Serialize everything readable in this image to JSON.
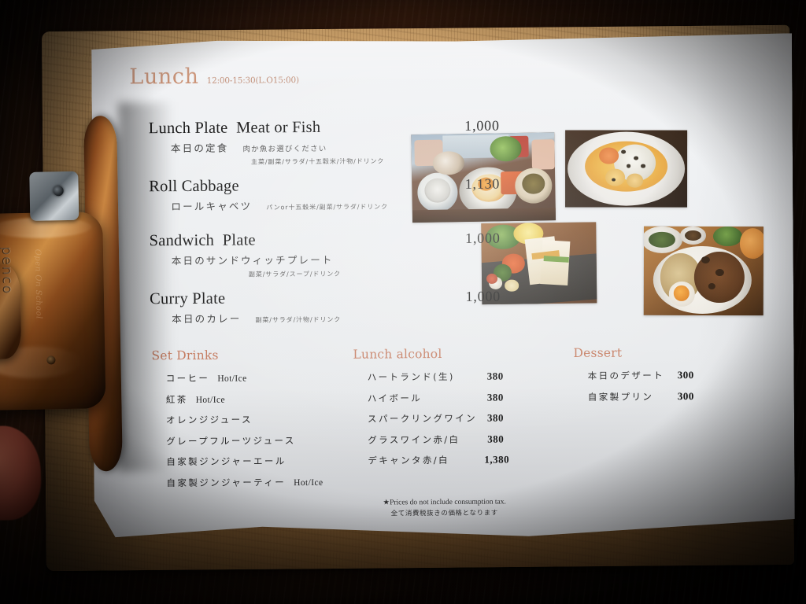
{
  "menu": {
    "section_title": "Lunch",
    "hours": "12:00-15:30(L.O15:00)",
    "items": [
      {
        "name": "Lunch Plate  Meat or Fish",
        "price": "1,000",
        "jp": "本日の定食",
        "jp_note": "肉か魚お選びください",
        "sub": "主菜/副菜/サラダ/十五穀米/汁物/ドリンク"
      },
      {
        "name": "Roll Cabbage",
        "price": "1,130",
        "jp": "ロールキャベツ",
        "jp_note": "",
        "sub": "パンor十五穀米/副菜/サラダ/ドリンク"
      },
      {
        "name": "Sandwich  Plate",
        "price": "1,000",
        "jp": "本日のサンドウィッチプレート",
        "jp_note": "",
        "sub": "副菜/サラダ/スープ/ドリンク"
      },
      {
        "name": "Curry Plate",
        "price": "1,000",
        "jp": "本日のカレー",
        "jp_note": "",
        "sub": "副菜/サラダ/汁物/ドリンク"
      }
    ],
    "photos": [
      {
        "name": "lunch-plate-photo"
      },
      {
        "name": "roll-cabbage-photo"
      },
      {
        "name": "sandwich-plate-photo"
      },
      {
        "name": "curry-plate-photo"
      }
    ],
    "columns": [
      {
        "heading": "Set Drinks",
        "rows": [
          {
            "name": "コーヒー",
            "note": "Hot/Ice",
            "price": ""
          },
          {
            "name": "紅茶",
            "note": "Hot/Ice",
            "price": ""
          },
          {
            "name": "オレンジジュース",
            "note": "",
            "price": ""
          },
          {
            "name": "グレープフルーツジュース",
            "note": "",
            "price": ""
          },
          {
            "name": "自家製ジンジャーエール",
            "note": "",
            "price": ""
          },
          {
            "name": "自家製ジンジャーティー",
            "note": "Hot/Ice",
            "price": ""
          }
        ]
      },
      {
        "heading": "Lunch alcohol",
        "rows": [
          {
            "name": "ハートランド(生)",
            "note": "",
            "price": "380"
          },
          {
            "name": "ハイボール",
            "note": "",
            "price": "380"
          },
          {
            "name": "スパークリングワイン",
            "note": "",
            "price": "380"
          },
          {
            "name": "グラスワイン赤/白",
            "note": "",
            "price": "380"
          },
          {
            "name": "デキャンタ赤/白",
            "note": "",
            "price": "1,380"
          }
        ]
      },
      {
        "heading": "Dessert",
        "rows": [
          {
            "name": "本日のデザート",
            "note": "",
            "price": "300"
          },
          {
            "name": "自家製プリン",
            "note": "",
            "price": "300"
          }
        ]
      }
    ],
    "footnote_en": "★Prices do not include consumption tax.",
    "footnote_jp": "全て消費税抜きの価格となります"
  },
  "clip": {
    "brand": "penco",
    "tagline": "Open On School"
  },
  "colors": {
    "heading": "#c4795d",
    "title": "#c98f72",
    "paper": "#eef0f2",
    "board": "#bb8f59",
    "table": "#4a2512"
  }
}
